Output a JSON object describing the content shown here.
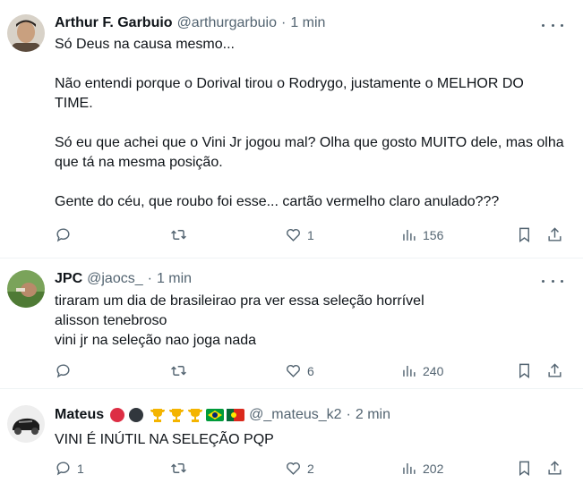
{
  "tweets": [
    {
      "name": "Arthur F. Garbuio",
      "handle": "@arthurgarbuio",
      "separator": "·",
      "time": "1 min",
      "paragraphs": [
        "Só Deus na causa mesmo...",
        "Não entendi porque o Dorival tirou o Rodrygo, justamente o MELHOR DO TIME.",
        "Só eu que achei que o Vini Jr jogou mal? Olha que gosto MUITO dele, mas olha que tá na mesma posição.",
        "Gente do céu, que roubo foi esse... cartão vermelho claro anulado???"
      ],
      "reply_count": "",
      "retweet_count": "",
      "like_count": "1",
      "view_count": "156"
    },
    {
      "name": "JPC",
      "handle": "@jaocs_",
      "separator": "·",
      "time": "1 min",
      "lines": [
        "tiraram um dia de brasileirao pra ver essa seleção horrível",
        "alisson tenebroso",
        "vini jr na seleção nao joga nada"
      ],
      "reply_count": "",
      "retweet_count": "",
      "like_count": "6",
      "view_count": "240"
    },
    {
      "name": "Mateus",
      "name_emojis": [
        "red-circle-icon",
        "black-circle-icon",
        "trophy-icon",
        "trophy-icon",
        "trophy-icon",
        "brazil-flag-icon",
        "portugal-flag-icon"
      ],
      "handle": "@_mateus_k2",
      "separator": "·",
      "time": "2 min",
      "lines": [
        "VINI É INÚTIL NA SELEÇÃO PQP"
      ],
      "reply_count": "1",
      "retweet_count": "",
      "like_count": "2",
      "view_count": "202"
    }
  ],
  "colors": {
    "text": "#0f1419",
    "secondary": "#536471",
    "divider": "#eff3f4"
  }
}
